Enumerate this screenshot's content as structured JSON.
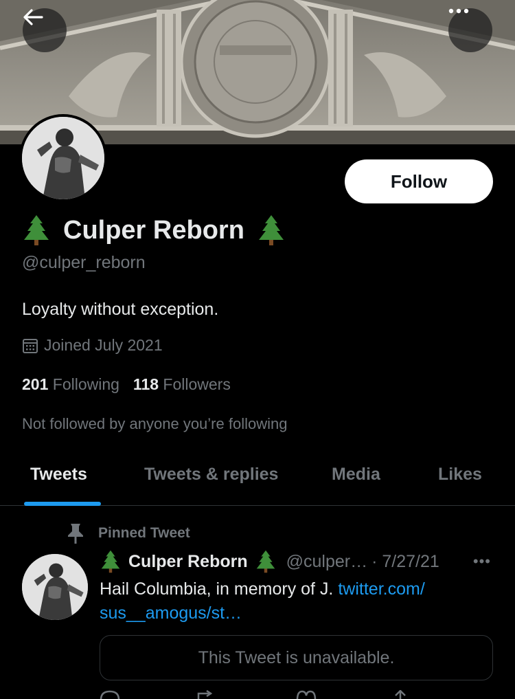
{
  "header": {
    "back_icon": "arrow-left-icon",
    "more_icon": "more-horizontal-icon"
  },
  "profile": {
    "display_name": "Culper Reborn",
    "name_emoji": "evergreen-tree",
    "handle": "@culper_reborn",
    "follow_label": "Follow",
    "bio": "Loyalty without exception.",
    "joined": "Joined July 2021",
    "following_count": "201",
    "following_label": "Following",
    "followers_count": "118",
    "followers_label": "Followers",
    "not_followed": "Not followed by anyone you’re following"
  },
  "tabs": [
    {
      "label": "Tweets",
      "active": true
    },
    {
      "label": "Tweets & replies",
      "active": false
    },
    {
      "label": "Media",
      "active": false
    },
    {
      "label": "Likes",
      "active": false
    }
  ],
  "tweet": {
    "pinned_label": "Pinned Tweet",
    "author_name": "Culper Reborn",
    "author_handle": "@culper…",
    "date": "· 7/27/21",
    "text": "Hail Columbia, in memory of J.",
    "link_line1": "twitter.com/",
    "link_line2": "sus__amogus/st…",
    "unavailable": "This Tweet is unavailable."
  },
  "colors": {
    "accent": "#1d9bf0",
    "background": "#000000",
    "muted": "#71767b",
    "text": "#e7e9ea"
  }
}
